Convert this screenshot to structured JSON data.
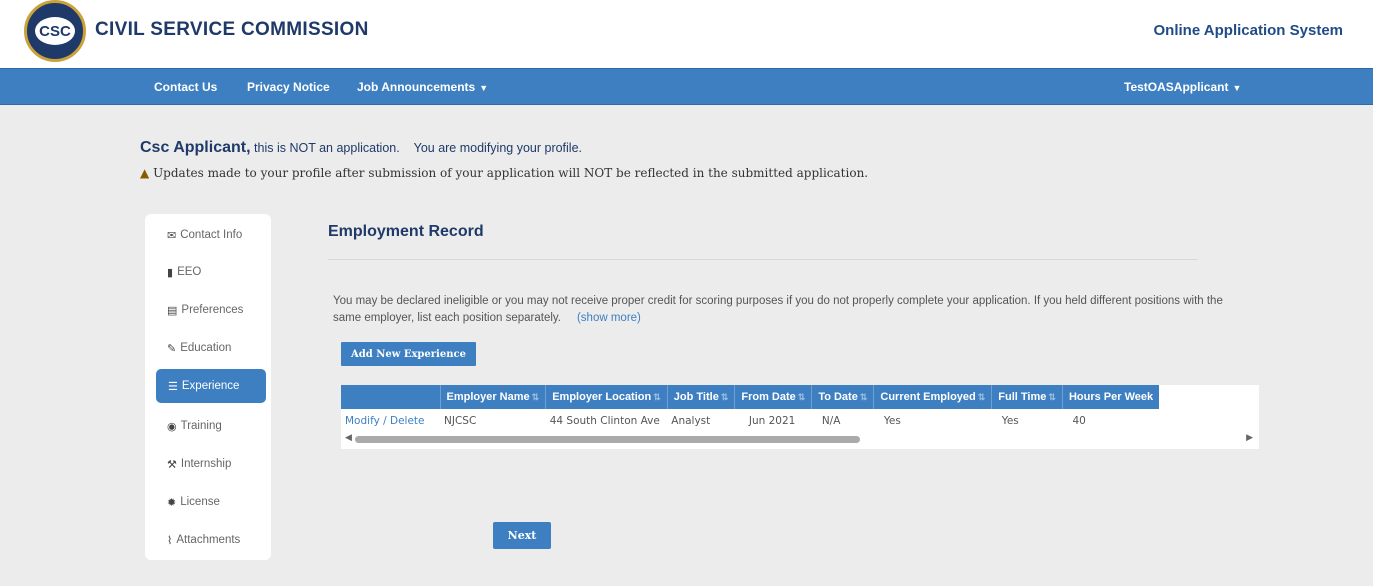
{
  "header": {
    "logo_text": "CSC",
    "org_title": "CIVIL SERVICE COMMISSION",
    "system_title": "Online Application System"
  },
  "nav": {
    "items": [
      {
        "label": "Contact Us"
      },
      {
        "label": "Privacy Notice"
      },
      {
        "label": "Job Announcements"
      }
    ],
    "user": "TestOASApplicant"
  },
  "notice": {
    "applicant": "Csc Applicant,",
    "line1": "this is NOT an application.",
    "line1b": "You are modifying your profile.",
    "line2": "Updates made to your profile after submission of your application will NOT be reflected in the submitted application."
  },
  "sidebar": {
    "items": [
      {
        "label": "Contact Info",
        "icon": "envelope-icon"
      },
      {
        "label": "EEO",
        "icon": "bookmark-icon"
      },
      {
        "label": "Preferences",
        "icon": "list-icon"
      },
      {
        "label": "Education",
        "icon": "graduation-cap-icon"
      },
      {
        "label": "Experience",
        "icon": "bars-icon"
      },
      {
        "label": "Training",
        "icon": "eye-icon"
      },
      {
        "label": "Internship",
        "icon": "wrench-icon"
      },
      {
        "label": "License",
        "icon": "certificate-icon"
      },
      {
        "label": "Attachments",
        "icon": "paperclip-icon"
      }
    ],
    "active": "Experience"
  },
  "main": {
    "title": "Employment Record",
    "description": "You may be declared ineligible or you may not receive proper credit for scoring purposes if you do not properly complete your application. If you held different positions with the same employer, list each position separately.",
    "show_more": "(show more)",
    "add_button": "Add New Experience",
    "next_button": "Next"
  },
  "table": {
    "columns": [
      "",
      "Employer Name",
      "Employer Location",
      "Job Title",
      "From Date",
      "To Date",
      "Current Employed",
      "Full Time",
      "Hours Per Week"
    ],
    "rows": [
      {
        "action": "Modify / Delete",
        "employer_name": "NJCSC",
        "employer_location": "44 South Clinton Ave",
        "job_title": "Analyst",
        "from_date": "Jun 2021",
        "to_date": "N/A",
        "current_employed": "Yes",
        "full_time": "Yes",
        "hours_per_week": "40"
      }
    ]
  },
  "colors": {
    "primary": "#3d7fc1",
    "brand_navy": "#1f3a68",
    "background": "#ececec"
  }
}
